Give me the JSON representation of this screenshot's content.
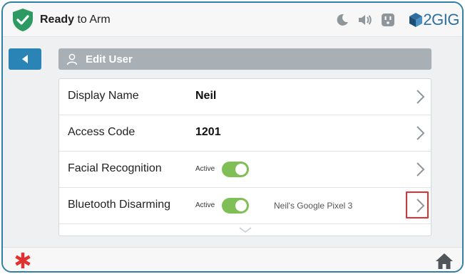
{
  "status": {
    "bold": "Ready",
    "rest": " to Arm"
  },
  "top_icons": [
    "moon-icon",
    "speaker-icon",
    "outlet-icon"
  ],
  "brand": {
    "name": "2GIG"
  },
  "header": {
    "title": "Edit User"
  },
  "rows": [
    {
      "label": "Display Name",
      "value": "Neil"
    },
    {
      "label": "Access Code",
      "value": "1201"
    },
    {
      "label": "Facial Recognition",
      "status": "Active",
      "toggle_on": true
    },
    {
      "label": "Bluetooth Disarming",
      "status": "Active",
      "toggle_on": true,
      "device": "Neil's Google Pixel 3",
      "highlighted": true
    }
  ],
  "colors": {
    "accent": "#2a84b6",
    "toggle_on": "#7fbf55",
    "emergency": "#e03131",
    "shield": "#2e9a63",
    "header_bar": "#a9b0b5"
  },
  "bottom": {
    "left_icon": "emergency-star-icon",
    "right_icon": "home-icon"
  }
}
